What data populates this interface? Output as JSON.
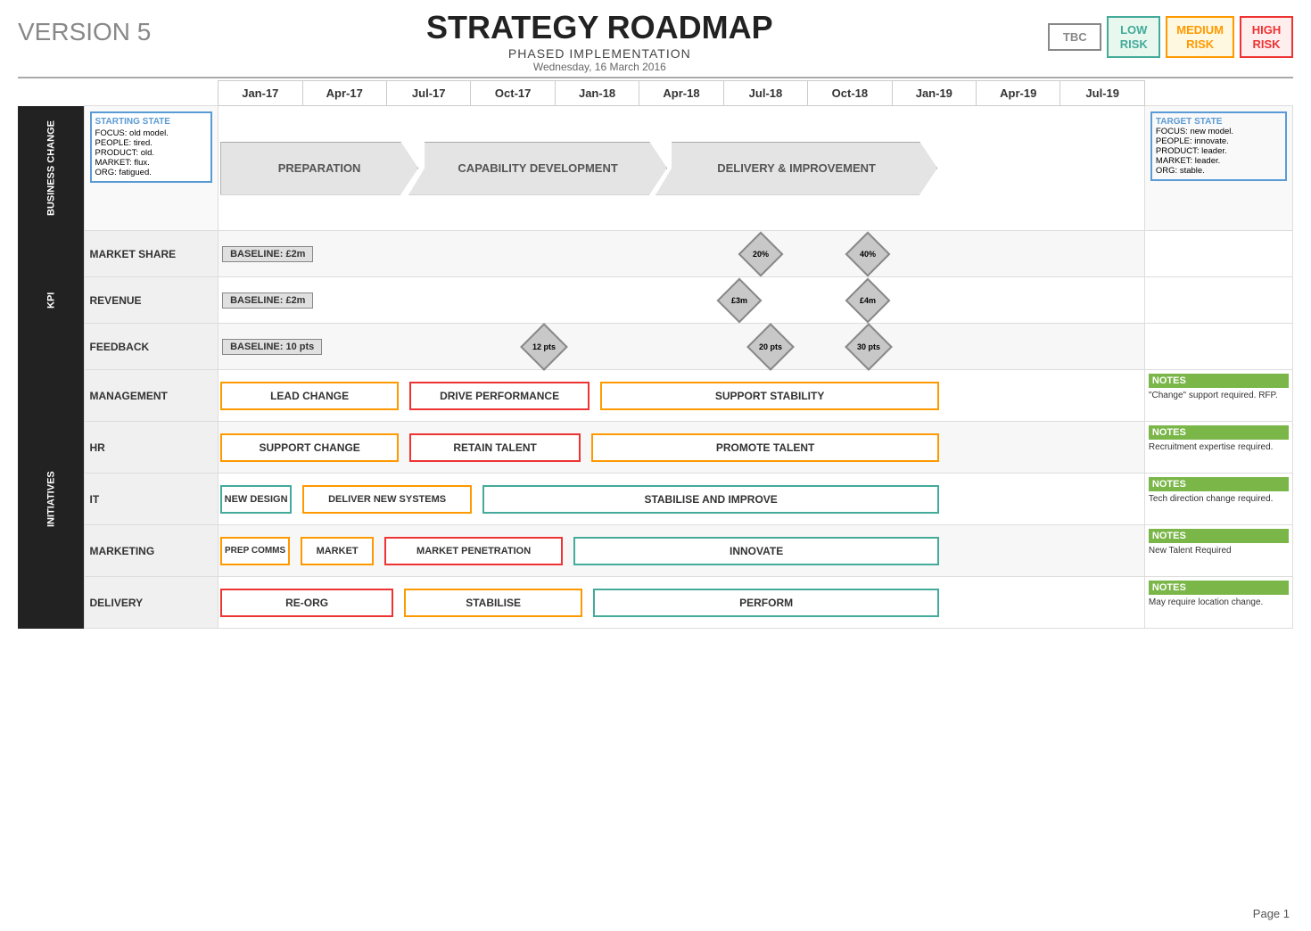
{
  "header": {
    "version": "VERSION 5",
    "title": "STRATEGY ROADMAP",
    "subtitle": "PHASED IMPLEMENTATION",
    "date": "Wednesday, 16 March 2016",
    "risk_badges": [
      {
        "label": "TBC",
        "class": "tbc"
      },
      {
        "label": "LOW\nRISK",
        "class": "low"
      },
      {
        "label": "MEDIUM\nRISK",
        "class": "medium"
      },
      {
        "label": "HIGH\nRISK",
        "class": "high"
      }
    ]
  },
  "timeline": {
    "columns": [
      "Jan-17",
      "Apr-17",
      "Jul-17",
      "Oct-17",
      "Jan-18",
      "Apr-18",
      "Jul-18",
      "Oct-18",
      "Jan-19",
      "Apr-19",
      "Jul-19"
    ]
  },
  "biz_change": {
    "section_label": "BUSINESS CHANGE",
    "starting_state": {
      "title": "STARTING STATE",
      "lines": [
        "FOCUS: old model.",
        "PEOPLE: tired.",
        "PRODUCT: old.",
        "MARKET: flux.",
        "ORG: fatigued."
      ]
    },
    "target_state": {
      "title": "TARGET STATE",
      "lines": [
        "FOCUS: new model.",
        "PEOPLE: innovate.",
        "PRODUCT: leader.",
        "MARKET: leader.",
        "ORG: stable."
      ]
    },
    "phases": [
      {
        "label": "PREPARATION",
        "start_pct": 0,
        "width_pct": 30
      },
      {
        "label": "CAPABILITY DEVELOPMENT",
        "start_pct": 28,
        "width_pct": 38
      },
      {
        "label": "DELIVERY & IMPROVEMENT",
        "start_pct": 64,
        "width_pct": 36
      }
    ]
  },
  "kpi": {
    "section_label": "KPI",
    "rows": [
      {
        "label": "MARKET SHARE",
        "baseline": "BASELINE: £2m",
        "milestones": [
          {
            "label": "20%",
            "col": "Oct-18",
            "pos_pct": 78
          },
          {
            "label": "40%",
            "col": "Apr-19",
            "pos_pct": 92
          }
        ]
      },
      {
        "label": "REVENUE",
        "baseline": "BASELINE: £2m",
        "milestones": [
          {
            "label": "£3m",
            "col": "Oct-18",
            "pos_pct": 74
          },
          {
            "label": "£4m",
            "col": "Apr-19",
            "pos_pct": 93
          }
        ]
      },
      {
        "label": "FEEDBACK",
        "baseline": "BASELINE: 10 pts",
        "milestones": [
          {
            "label": "12 pts",
            "col": "Apr-18",
            "pos_pct": 48
          },
          {
            "label": "20 pts",
            "col": "Jan-19",
            "pos_pct": 82
          },
          {
            "label": "30 pts",
            "col": "Apr-19",
            "pos_pct": 94
          }
        ]
      }
    ]
  },
  "initiatives": {
    "section_label": "INITIATIVES",
    "rows": [
      {
        "label": "MANAGEMENT",
        "bars": [
          {
            "label": "LEAD CHANGE",
            "start_pct": 1,
            "width_pct": 28,
            "color": "bar-o"
          },
          {
            "label": "DRIVE PERFORMANCE",
            "start_pct": 30,
            "width_pct": 28,
            "color": "bar-r"
          },
          {
            "label": "SUPPORT STABILITY",
            "start_pct": 59,
            "width_pct": 32,
            "color": "bar-o"
          }
        ],
        "notes": {
          "title": "NOTES",
          "content": "\"Change\" support required. RFP."
        }
      },
      {
        "label": "HR",
        "bars": [
          {
            "label": "SUPPORT CHANGE",
            "start_pct": 1,
            "width_pct": 28,
            "color": "bar-o"
          },
          {
            "label": "RETAIN TALENT",
            "start_pct": 30,
            "width_pct": 27,
            "color": "bar-r"
          },
          {
            "label": "PROMOTE TALENT",
            "start_pct": 58,
            "width_pct": 33,
            "color": "bar-o"
          }
        ],
        "notes": {
          "title": "NOTES",
          "content": "Recruitment expertise required."
        }
      },
      {
        "label": "IT",
        "bars": [
          {
            "label": "NEW DESIGN",
            "start_pct": 1,
            "width_pct": 11,
            "color": "bar-g"
          },
          {
            "label": "DELIVER NEW SYSTEMS",
            "start_pct": 13,
            "width_pct": 26,
            "color": "bar-o"
          },
          {
            "label": "STABILISE AND IMPROVE",
            "start_pct": 40,
            "width_pct": 51,
            "color": "bar-g"
          }
        ],
        "notes": {
          "title": "NOTES",
          "content": "Tech direction change required."
        }
      },
      {
        "label": "MARKETING",
        "bars": [
          {
            "label": "PREP COMMS",
            "start_pct": 1,
            "width_pct": 11,
            "color": "bar-o"
          },
          {
            "label": "MARKET",
            "start_pct": 13,
            "width_pct": 12,
            "color": "bar-o"
          },
          {
            "label": "MARKET PENETRATION",
            "start_pct": 26,
            "width_pct": 27,
            "color": "bar-r"
          },
          {
            "label": "INNOVATE",
            "start_pct": 54,
            "width_pct": 37,
            "color": "bar-g"
          }
        ],
        "notes": {
          "title": "NOTES",
          "content": "New Talent Required"
        }
      },
      {
        "label": "DELIVERY",
        "bars": [
          {
            "label": "RE-ORG",
            "start_pct": 1,
            "width_pct": 27,
            "color": "bar-r"
          },
          {
            "label": "STABILISE",
            "start_pct": 29,
            "width_pct": 28,
            "color": "bar-o"
          },
          {
            "label": "PERFORM",
            "start_pct": 58,
            "width_pct": 33,
            "color": "bar-g"
          }
        ],
        "notes": {
          "title": "NOTES",
          "content": "May require location change."
        }
      }
    ]
  },
  "page": "Page 1"
}
